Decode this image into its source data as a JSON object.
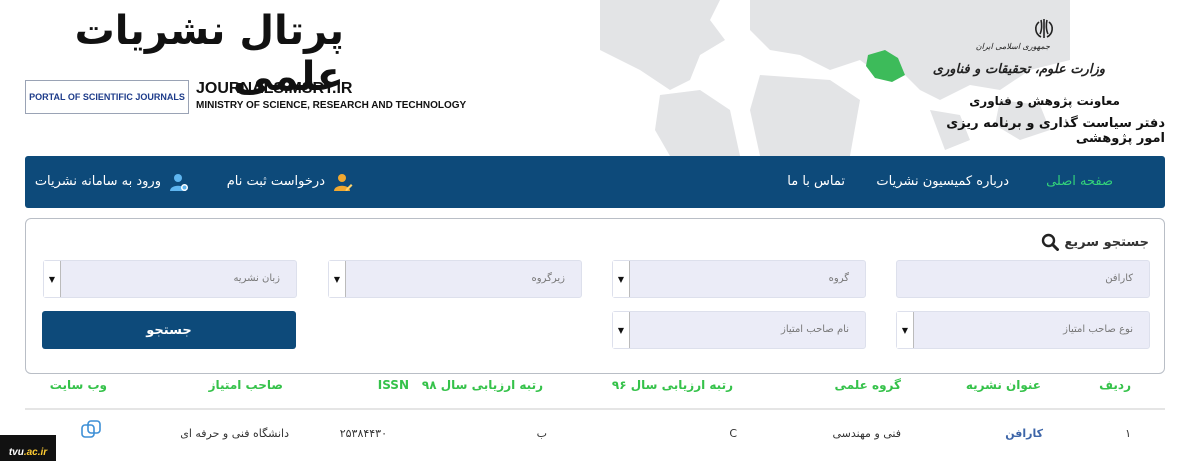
{
  "header": {
    "portal_title_fa": "پرتال نشریات علمی",
    "logo_text": "PORTAL OF SCIENTIFIC JOURNALS",
    "site_url": "JOURNALS.MSRT.IR",
    "ministry_en": "MINISTRY OF SCIENCE, RESEARCH AND TECHNOLOGY",
    "gov_republic": "جمهوری اسلامی ایران",
    "gov_ministry": "وزارت علوم، تحقیقات و فناوری",
    "gov_deputy": "معاونت پژوهش و فناوری",
    "gov_office": "دفتر سیاست گذاری و برنامه ریزی امور پژوهشی"
  },
  "nav": {
    "home": "صفحه اصلی",
    "about": "درباره کمیسیون نشریات",
    "contact": "تماس با ما",
    "register": "درخواست ثبت نام",
    "login": "ورود به سامانه نشریات"
  },
  "search": {
    "title": "جستجو سریع",
    "publisher_placeholder": "کارافن",
    "group_placeholder": "گروه",
    "subgroup_placeholder": "زیرگروه",
    "language_placeholder": "زبان نشریه",
    "owner_type_placeholder": "نوع صاحب امتیاز",
    "owner_name_placeholder": "نام صاحب امتیاز",
    "button_label": "جستجو"
  },
  "table": {
    "headers": [
      "ردیف",
      "عنوان نشریه",
      "گروه علمی",
      "رتبه ارزیابی سال ۹۶",
      "رتبه ارزیابی سال ۹۸",
      "ISSN",
      "صاحب امتیاز",
      "وب سایت"
    ],
    "rows": [
      {
        "index": "۱",
        "title": "کارافن",
        "group": "فنی و مهندسی",
        "rank96": "C",
        "rank98": "ب",
        "issn": "۲۵۳۸۴۴۳۰",
        "owner": "دانشگاه فنی و حرفه ای"
      }
    ]
  },
  "badge": {
    "prefix": "tvu",
    "domain": ".ac.ir"
  },
  "colors": {
    "primary": "#0d4a7a",
    "accent_green": "#35c24a",
    "field_bg": "#ebecf7"
  }
}
